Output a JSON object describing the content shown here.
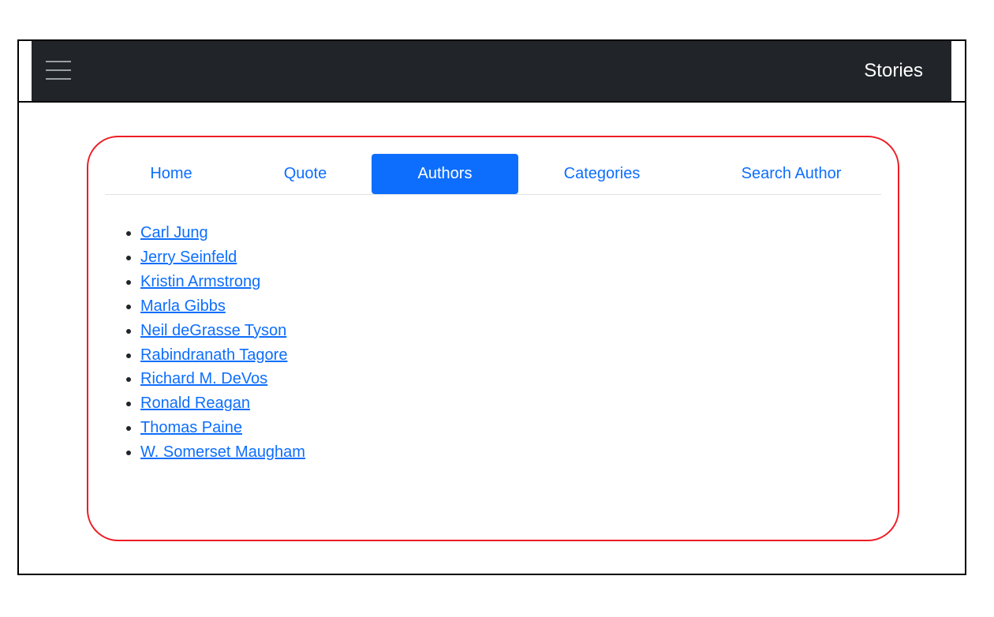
{
  "navbar": {
    "brand": "Stories",
    "menu_icon": "hamburger-menu-icon"
  },
  "tabs": [
    {
      "label": "Home",
      "active": false
    },
    {
      "label": "Quote",
      "active": false
    },
    {
      "label": "Authors",
      "active": true
    },
    {
      "label": "Categories",
      "active": false
    },
    {
      "label": "Search Author",
      "active": false
    }
  ],
  "authors": [
    "Carl Jung",
    "Jerry Seinfeld",
    "Kristin Armstrong",
    "Marla Gibbs",
    "Neil deGrasse Tyson",
    "Rabindranath Tagore",
    "Richard M. DeVos",
    "Ronald Reagan",
    "Thomas Paine",
    "W. Somerset Maugham"
  ],
  "colors": {
    "navbar_bg": "#212529",
    "accent": "#0d6efd",
    "card_border": "#ee1c25"
  }
}
